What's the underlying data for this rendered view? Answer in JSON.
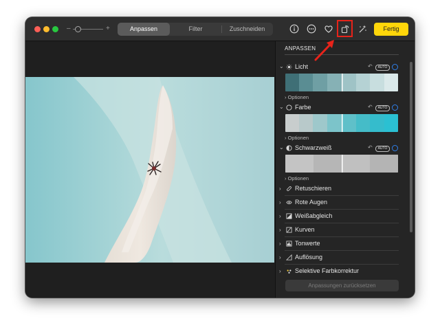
{
  "toolbar": {
    "tabs": [
      "Anpassen",
      "Filter",
      "Zuschneiden"
    ],
    "active_tab": "Anpassen",
    "zoom_minus": "–",
    "zoom_plus": "+",
    "done_label": "Fertig",
    "done_color": "#ffd60a",
    "icons": [
      "info-icon",
      "more-icon",
      "favorite-heart-icon",
      "rotate-icon",
      "auto-enhance-magic-wand-icon"
    ]
  },
  "sidebar": {
    "header": "ANPASSEN",
    "sections": [
      {
        "title": "Licht",
        "icon": "sun-icon",
        "auto": "AUTO",
        "options": "Optionen"
      },
      {
        "title": "Farbe",
        "icon": "color-circle-icon",
        "auto": "AUTO",
        "options": "Optionen"
      },
      {
        "title": "Schwarzweiß",
        "icon": "half-circle-icon",
        "auto": "AUTO",
        "options": "Optionen"
      }
    ],
    "rows": [
      {
        "label": "Retuschieren",
        "icon": "bandage-icon"
      },
      {
        "label": "Rote Augen",
        "icon": "eye-icon"
      },
      {
        "label": "Weißabgleich",
        "icon": "white-balance-icon"
      },
      {
        "label": "Kurven",
        "icon": "curves-icon"
      },
      {
        "label": "Tonwerte",
        "icon": "levels-icon"
      },
      {
        "label": "Auflösung",
        "icon": "definition-icon"
      },
      {
        "label": "Selektive Farbkorrektur",
        "icon": "selective-color-icon"
      }
    ],
    "reset_label": "Anpassungen zurücksetzen",
    "accent_color": "#2f80ed"
  },
  "annotation": {
    "highlight_color": "#e8231a"
  }
}
